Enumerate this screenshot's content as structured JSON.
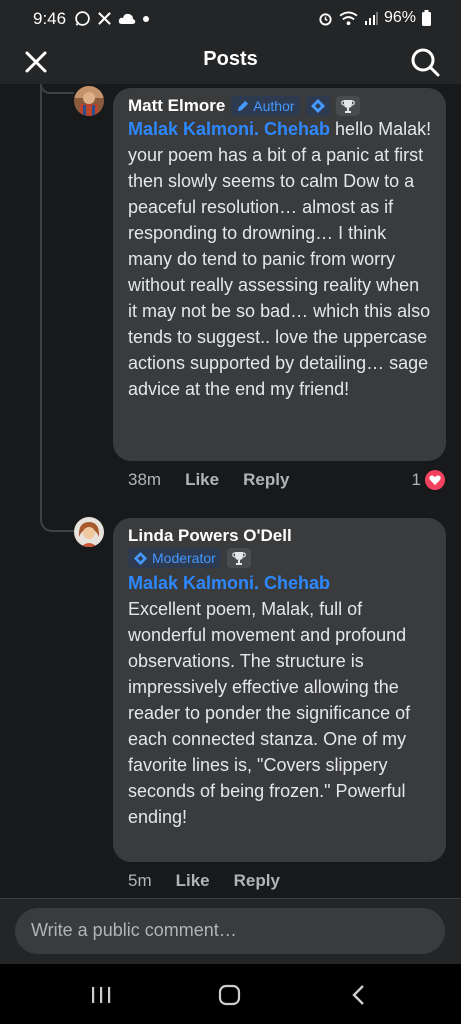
{
  "status_bar": {
    "time": "9:46",
    "battery": "96%",
    "left_icons": [
      "whatsapp-icon",
      "x-icon",
      "cloud-icon",
      "dot-icon"
    ],
    "right_icons": [
      "alarm-icon",
      "wifi-icon",
      "signal-icon",
      "battery-icon"
    ]
  },
  "header": {
    "title": "Posts"
  },
  "comments": [
    {
      "author": "Matt Elmore",
      "badge": "Author",
      "mention": "Malak Kalmoni. Chehab",
      "text": " hello Malak! your poem has a bit of a panic at first then slowly seems to calm Dow to a peaceful resolution… almost as if responding to drowning… I think many do tend to panic from worry without really assessing reality when it may not be so bad… which this also tends to suggest.. love the uppercase actions supported by detailing… sage advice at the end my friend!",
      "time": "38m",
      "like_label": "Like",
      "reply_label": "Reply",
      "reactions": "1"
    },
    {
      "author": "Linda Powers O'Dell",
      "badge": "Moderator",
      "mention": "Malak Kalmoni. Chehab",
      "text": "Excellent poem, Malak, full of wonderful movement and profound observations. The structure is impressively effective allowing the reader to ponder the significance of each connected stanza. One of my favorite lines is, \"Covers slippery seconds of being frozen.\" Powerful ending!",
      "time": "5m",
      "like_label": "Like",
      "reply_label": "Reply"
    }
  ],
  "composer": {
    "placeholder": "Write a public comment…"
  },
  "colors": {
    "background": "#18191a",
    "bubble": "#3a3b3c",
    "mention": "#2d88ff",
    "badge_text": "#4599ff",
    "heart": "#f3425f"
  }
}
